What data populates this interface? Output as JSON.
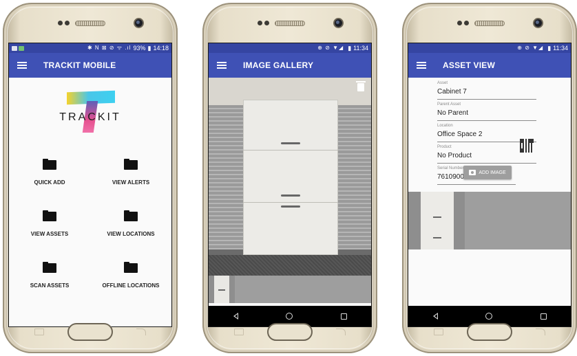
{
  "phone1": {
    "status_time": "14:18",
    "status_battery": "93%",
    "status_icons": "✱ N ⊠ ⊘ ᯤ .ıl",
    "app_title": "TRACKIT MOBILE",
    "logo_text": "TRACKIT",
    "menu": [
      {
        "label": "QUICK ADD",
        "icon": "folder-icon"
      },
      {
        "label": "VIEW ALERTS",
        "icon": "folder-icon"
      },
      {
        "label": "VIEW ASSETS",
        "icon": "folder-icon"
      },
      {
        "label": "VIEW LOCATIONS",
        "icon": "folder-icon"
      },
      {
        "label": "SCAN ASSETS",
        "icon": "folder-icon"
      },
      {
        "label": "OFFLINE LOCATIONS",
        "icon": "folder-icon"
      }
    ]
  },
  "phone2": {
    "status_time": "11:34",
    "status_icons": "⊕ ⊘ ▼◢",
    "app_title": "IMAGE GALLERY"
  },
  "phone3": {
    "status_time": "11:34",
    "status_icons": "⊕ ⊘ ▼◢",
    "app_title": "ASSET VIEW",
    "fields": [
      {
        "label": "Asset",
        "value": "Cabinet 7"
      },
      {
        "label": "Parent Asset",
        "value": "No Parent"
      },
      {
        "label": "Location",
        "value": "Office Space 2"
      },
      {
        "label": "Product",
        "value": "No Product"
      },
      {
        "label": "Serial Number",
        "value": "7610900020089"
      }
    ],
    "add_image_label": "ADD IMAGE"
  },
  "colors": {
    "app_bar": "#3f51b5",
    "status_bar": "#3545a2",
    "phone_gold": "#e7dfca"
  }
}
